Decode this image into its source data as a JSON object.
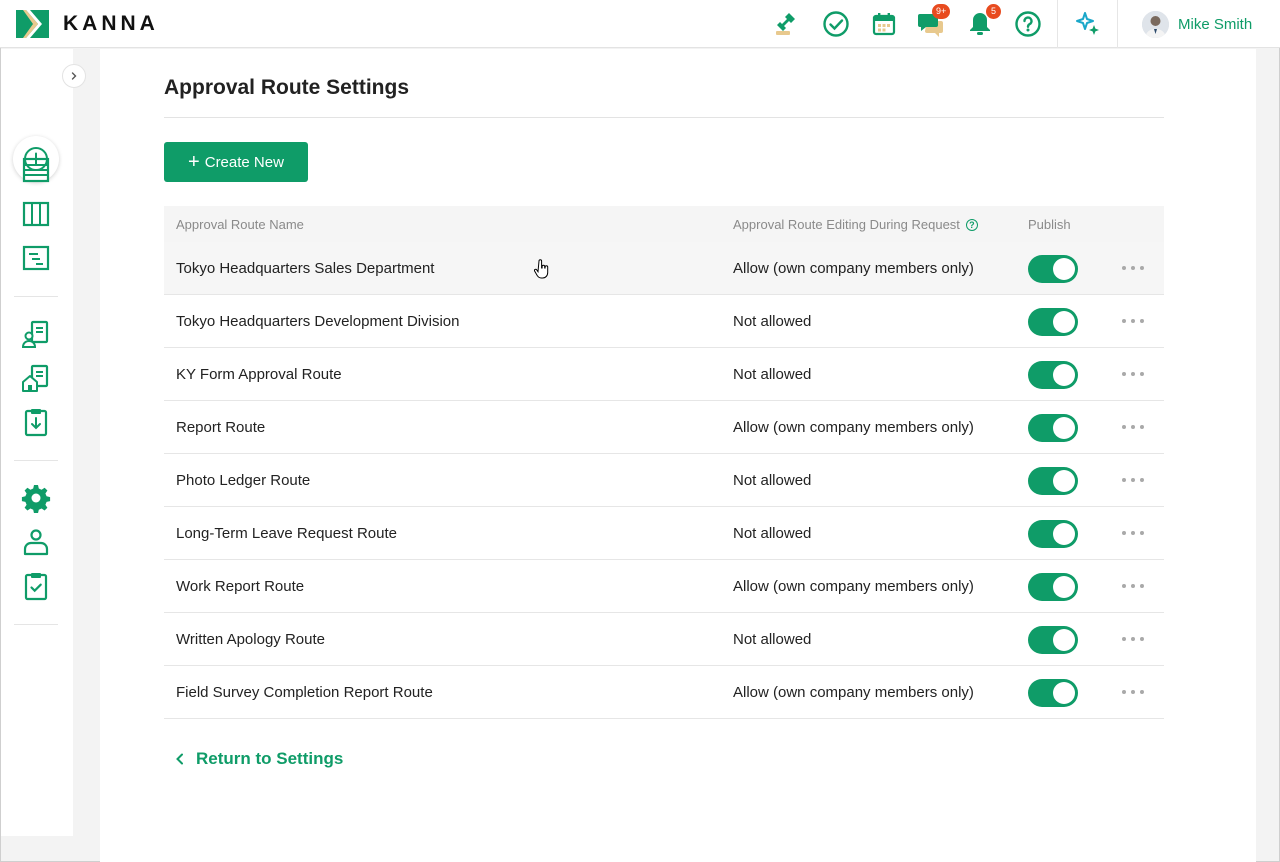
{
  "brand": {
    "name": "KANNA",
    "accent": "#0f9c68"
  },
  "header": {
    "icons": [
      {
        "name": "stamp-icon"
      },
      {
        "name": "check-circle-icon"
      },
      {
        "name": "calendar-icon"
      },
      {
        "name": "chat-icon",
        "badge": "9+"
      },
      {
        "name": "bell-icon",
        "badge": "5"
      },
      {
        "name": "help-icon"
      },
      {
        "name": "sparkle-ai-icon"
      }
    ],
    "user_name": "Mike Smith"
  },
  "page": {
    "title": "Approval Route Settings",
    "create_label": "Create New",
    "back_label": "Return to Settings"
  },
  "table": {
    "columns": [
      "Approval Route Name",
      "Approval Route Editing During Request",
      "Publish"
    ],
    "rows": [
      {
        "name": "Tokyo Headquarters Sales Department",
        "editing": "Allow (own company members only)",
        "published": true
      },
      {
        "name": "Tokyo Headquarters Development Division",
        "editing": "Not allowed",
        "published": true
      },
      {
        "name": "KY Form Approval Route",
        "editing": "Not allowed",
        "published": true
      },
      {
        "name": "Report Route",
        "editing": "Allow (own company members only)",
        "published": true
      },
      {
        "name": "Photo Ledger Route",
        "editing": "Not allowed",
        "published": true
      },
      {
        "name": "Long-Term Leave Request Route",
        "editing": "Not allowed",
        "published": true
      },
      {
        "name": "Work Report Route",
        "editing": "Allow (own company members only)",
        "published": true
      },
      {
        "name": "Written Apology Route",
        "editing": "Not allowed",
        "published": true
      },
      {
        "name": "Field Survey Completion Report Route",
        "editing": "Allow (own company members only)",
        "published": true
      }
    ]
  }
}
